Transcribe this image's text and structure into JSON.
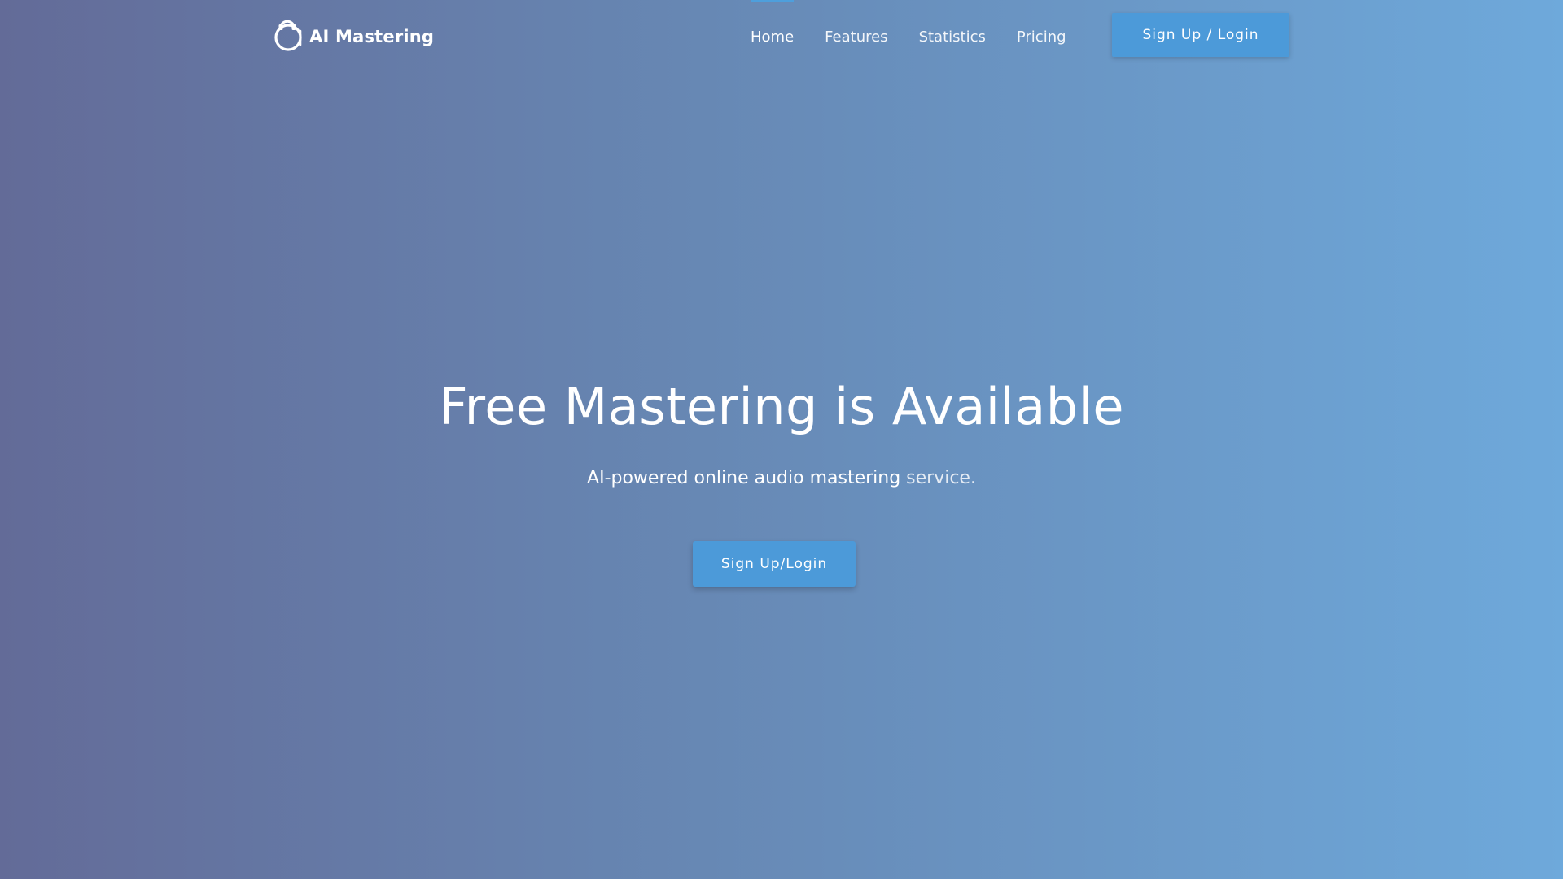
{
  "header": {
    "brand": {
      "name": "AI Mastering",
      "logo_icon": "headphones-logo-icon"
    },
    "nav": [
      {
        "label": "Home",
        "active": true
      },
      {
        "label": "Features",
        "active": false
      },
      {
        "label": "Statistics",
        "active": false
      },
      {
        "label": "Pricing",
        "active": false
      }
    ],
    "cta_label": "Sign Up / Login"
  },
  "hero": {
    "title": "Free Mastering is Available",
    "subtitle_main": "AI-powered online audio mastering",
    "subtitle_tail": " service.",
    "cta_label": "Sign Up/Login"
  },
  "colors": {
    "background_start": "#636b98",
    "background_end": "#6ea9db",
    "button": "#4c9ad9",
    "active_indicator": "#4e9fdc",
    "text": "#ffffff"
  }
}
